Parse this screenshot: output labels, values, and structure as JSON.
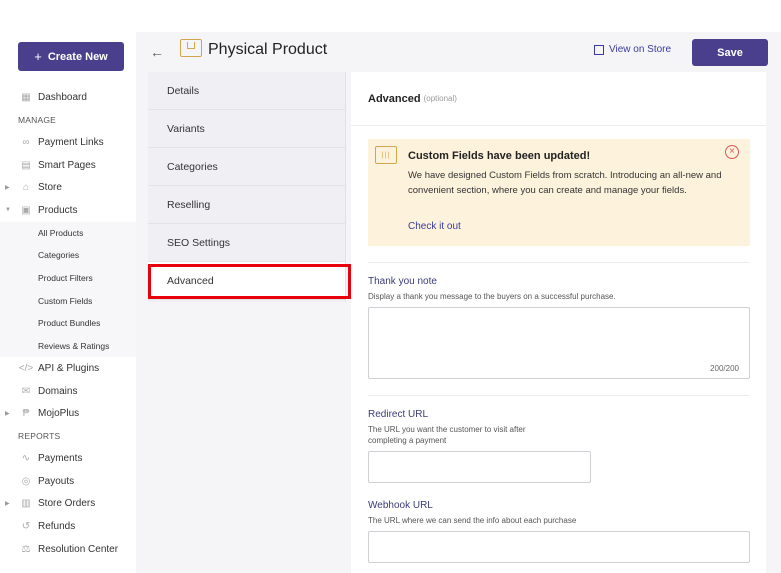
{
  "sidebar": {
    "create_label": "Create New",
    "dashboard": "Dashboard",
    "manage_heading": "MANAGE",
    "payment_links": "Payment Links",
    "smart_pages": "Smart Pages",
    "store": "Store",
    "products": "Products",
    "product_subitems": [
      "All Products",
      "Categories",
      "Product Filters",
      "Custom Fields",
      "Product Bundles",
      "Reviews & Ratings"
    ],
    "api_plugins": "API & Plugins",
    "domains": "Domains",
    "mojoplus": "MojoPlus",
    "reports_heading": "REPORTS",
    "payments": "Payments",
    "payouts": "Payouts",
    "store_orders": "Store Orders",
    "refunds": "Refunds",
    "resolution_center": "Resolution Center"
  },
  "header": {
    "title": "Physical Product",
    "view_on_store": "View on Store",
    "save_label": "Save"
  },
  "tabs": [
    "Details",
    "Variants",
    "Categories",
    "Reselling",
    "SEO Settings",
    "Advanced"
  ],
  "active_tab": "Advanced",
  "main": {
    "section_title": "Advanced",
    "section_optional": "(optional)",
    "notice": {
      "title": "Custom Fields have been updated!",
      "body": "We have designed Custom Fields from scratch. Introducing an all-new and convenient section, where you can create and manage your fields.",
      "link": "Check it out"
    },
    "thank_you": {
      "label": "Thank you note",
      "help": "Display a thank you message to the buyers on a successful purchase.",
      "count": "200/200"
    },
    "redirect": {
      "label": "Redirect URL",
      "help_line1": "The URL you want the customer to visit after",
      "help_line2": "completing a payment"
    },
    "webhook": {
      "label": "Webhook URL",
      "help": "The URL where we can send the info about each purchase"
    }
  },
  "colors": {
    "brand": "#4a3f8c",
    "highlight": "#e8000b",
    "notice_bg": "#fdf3dd"
  }
}
